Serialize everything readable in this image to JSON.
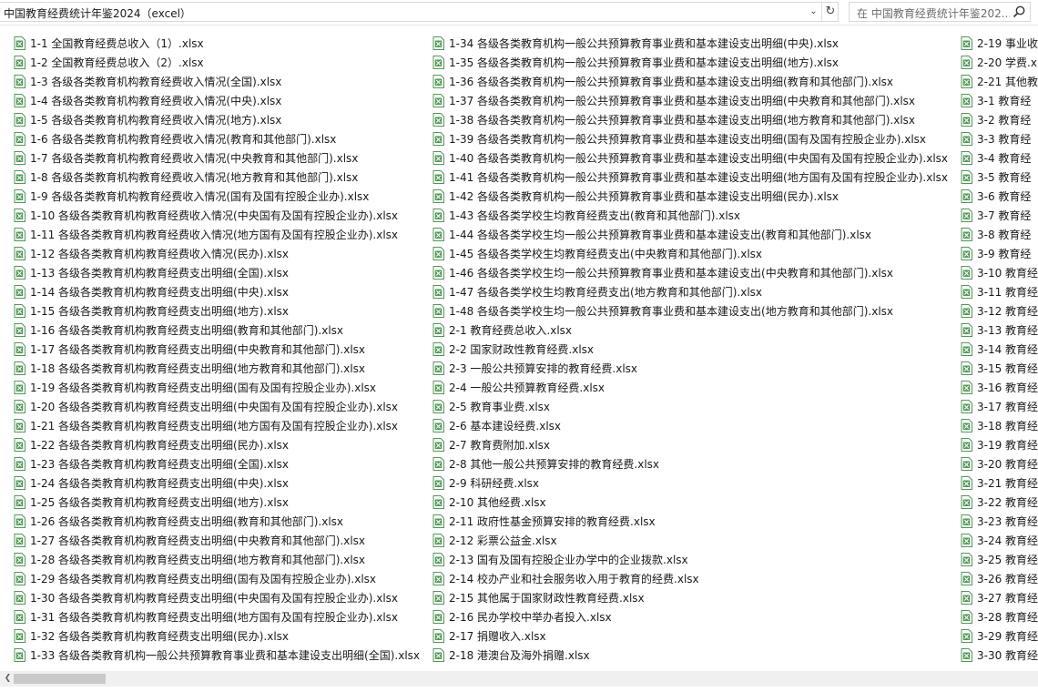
{
  "address": {
    "path": "中国教育经费统计年鉴2024（excel）"
  },
  "search": {
    "placeholder": "在 中国教育经费统计年鉴202..."
  },
  "icons": {
    "file": "excel-file-icon",
    "search": "search-icon",
    "refresh": "refresh-icon",
    "dropdown": "chevron-down-icon"
  },
  "colors": {
    "excel": "#4f9a55"
  },
  "columns": [
    [
      "1-1 全国教育经费总收入（1）.xlsx",
      "1-2 全国教育经费总收入（2）.xlsx",
      "1-3 各级各类教育机构教育经费收入情况(全国).xlsx",
      "1-4 各级各类教育机构教育经费收入情况(中央).xlsx",
      "1-5 各级各类教育机构教育经费收入情况(地方).xlsx",
      "1-6 各级各类教育机构教育经费收入情况(教育和其他部门).xlsx",
      "1-7 各级各类教育机构教育经费收入情况(中央教育和其他部门).xlsx",
      "1-8 各级各类教育机构教育经费收入情况(地方教育和其他部门).xlsx",
      "1-9 各级各类教育机构教育经费收入情况(国有及国有控股企业办).xlsx",
      "1-10 各级各类教育机构教育经费收入情况(中央国有及国有控股企业办).xlsx",
      "1-11 各级各类教育机构教育经费收入情况(地方国有及国有控股企业办).xlsx",
      "1-12 各级各类教育机构教育经费收入情况(民办).xlsx",
      "1-13 各级各类教育机构教育经费支出明细(全国).xlsx",
      "1-14 各级各类教育机构教育经费支出明细(中央).xlsx",
      "1-15 各级各类教育机构教育经费支出明细(地方).xlsx",
      "1-16 各级各类教育机构教育经费支出明细(教育和其他部门).xlsx",
      "1-17 各级各类教育机构教育经费支出明细(中央教育和其他部门).xlsx",
      "1-18 各级各类教育机构教育经费支出明细(地方教育和其他部门).xlsx",
      "1-19 各级各类教育机构教育经费支出明细(国有及国有控股企业办).xlsx",
      "1-20 各级各类教育机构教育经费支出明细(中央国有及国有控股企业办).xlsx",
      "1-21 各级各类教育机构教育经费支出明细(地方国有及国有控股企业办).xlsx",
      "1-22 各级各类教育机构教育经费支出明细(民办).xlsx",
      "1-23 各级各类教育机构教育经费支出明细(全国).xlsx",
      "1-24 各级各类教育机构教育经费支出明细(中央).xlsx",
      "1-25 各级各类教育机构教育经费支出明细(地方).xlsx",
      "1-26 各级各类教育机构教育经费支出明细(教育和其他部门).xlsx",
      "1-27 各级各类教育机构教育经费支出明细(中央教育和其他部门).xlsx",
      "1-28 各级各类教育机构教育经费支出明细(地方教育和其他部门).xlsx",
      "1-29 各级各类教育机构教育经费支出明细(国有及国有控股企业办).xlsx",
      "1-30 各级各类教育机构教育经费支出明细(中央国有及国有控股企业办).xlsx",
      "1-31 各级各类教育机构教育经费支出明细(地方国有及国有控股企业办).xlsx",
      "1-32 各级各类教育机构教育经费支出明细(民办).xlsx",
      "1-33 各级各类教育机构一般公共预算教育事业费和基本建设支出明细(全国).xlsx"
    ],
    [
      "1-34 各级各类教育机构一般公共预算教育事业费和基本建设支出明细(中央).xlsx",
      "1-35 各级各类教育机构一般公共预算教育事业费和基本建设支出明细(地方).xlsx",
      "1-36 各级各类教育机构一般公共预算教育事业费和基本建设支出明细(教育和其他部门).xlsx",
      "1-37 各级各类教育机构一般公共预算教育事业费和基本建设支出明细(中央教育和其他部门).xlsx",
      "1-38 各级各类教育机构一般公共预算教育事业费和基本建设支出明细(地方教育和其他部门).xlsx",
      "1-39 各级各类教育机构一般公共预算教育事业费和基本建设支出明细(国有及国有控股企业办).xlsx",
      "1-40 各级各类教育机构一般公共预算教育事业费和基本建设支出明细(中央国有及国有控股企业办).xlsx",
      "1-41 各级各类教育机构一般公共预算教育事业费和基本建设支出明细(地方国有及国有控股企业办).xlsx",
      "1-42 各级各类教育机构一般公共预算教育事业费和基本建设支出明细(民办).xlsx",
      "1-43 各级各类学校生均教育经费支出(教育和其他部门).xlsx",
      "1-44 各级各类学校生均一般公共预算教育事业费和基本建设支出(教育和其他部门).xlsx",
      "1-45 各级各类学校生均教育经费支出(中央教育和其他部门).xlsx",
      "1-46 各级各类学校生均一般公共预算教育事业费和基本建设支出(中央教育和其他部门).xlsx",
      "1-47 各级各类学校生均教育经费支出(地方教育和其他部门).xlsx",
      "1-48 各级各类学校生均一般公共预算教育事业费和基本建设支出(地方教育和其他部门).xlsx",
      "2-1 教育经费总收入.xlsx",
      "2-2 国家财政性教育经费.xlsx",
      "2-3 一般公共预算安排的教育经费.xlsx",
      "2-4 一般公共预算教育经费.xlsx",
      "2-5 教育事业费.xlsx",
      "2-6 基本建设经费.xlsx",
      "2-7 教育费附加.xlsx",
      "2-8 其他一般公共预算安排的教育经费.xlsx",
      "2-9 科研经费.xlsx",
      "2-10 其他经费.xlsx",
      "2-11 政府性基金预算安排的教育经费.xlsx",
      "2-12 彩票公益金.xlsx",
      "2-13 国有及国有控股企业办学中的企业拨款.xlsx",
      "2-14 校办产业和社会服务收入用于教育的经费.xlsx",
      "2-15 其他属于国家财政性教育经费.xlsx",
      "2-16 民办学校中举办者投入.xlsx",
      "2-17 捐赠收入.xlsx",
      "2-18 港澳台及海外捐赠.xlsx"
    ],
    [
      "2-19 事业收",
      "2-20 学费.xl",
      "2-21 其他教",
      "3-1 教育经",
      "3-2 教育经",
      "3-3 教育经",
      "3-4 教育经",
      "3-5 教育经",
      "3-6 教育经",
      "3-7 教育经",
      "3-8 教育经",
      "3-9 教育经",
      "3-10 教育经",
      "3-11 教育经",
      "3-12 教育经",
      "3-13 教育经",
      "3-14 教育经",
      "3-15 教育经",
      "3-16 教育经",
      "3-17 教育经",
      "3-18 教育经",
      "3-19 教育经",
      "3-20 教育经",
      "3-21 教育经",
      "3-22 教育经",
      "3-23 教育经",
      "3-24 教育经",
      "3-25 教育经",
      "3-26 教育经",
      "3-27 教育经",
      "3-28 教育经",
      "3-29 教育经",
      "3-30 教育经"
    ]
  ]
}
